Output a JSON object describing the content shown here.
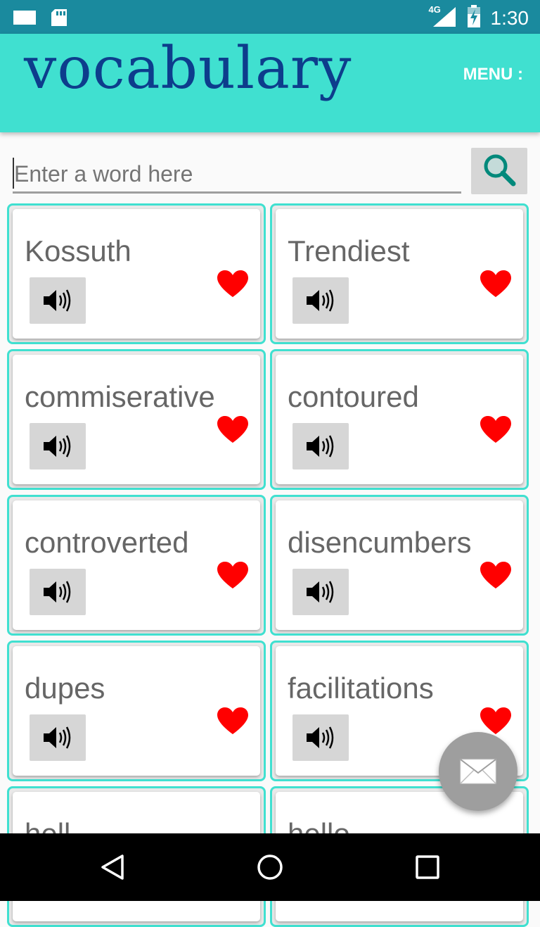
{
  "status_bar": {
    "time": "1:30",
    "network": "4G",
    "icons": [
      "window-icon",
      "sd-card-icon",
      "signal-icon",
      "battery-icon"
    ]
  },
  "app_bar": {
    "title": "vocabulary",
    "menu_label": "MENU :",
    "background": "#40e0d0",
    "title_color": "#0d3d8c"
  },
  "search": {
    "placeholder": "Enter a word here",
    "value": "",
    "icon": "search-icon"
  },
  "words": [
    {
      "word": "Kossuth"
    },
    {
      "word": "Trendiest"
    },
    {
      "word": "commiserative"
    },
    {
      "word": "contoured"
    },
    {
      "word": "controverted"
    },
    {
      "word": "disencumbers"
    },
    {
      "word": "dupes"
    },
    {
      "word": "facilitations"
    },
    {
      "word": "hell"
    },
    {
      "word": "hello"
    }
  ],
  "card_icons": {
    "speaker": "speaker-icon",
    "favorite": "heart-icon",
    "favorite_color": "#ff0000"
  },
  "fab": {
    "icon": "mail-icon"
  },
  "nav_bar": {
    "icons": [
      "back-icon",
      "home-icon",
      "recents-icon"
    ]
  }
}
